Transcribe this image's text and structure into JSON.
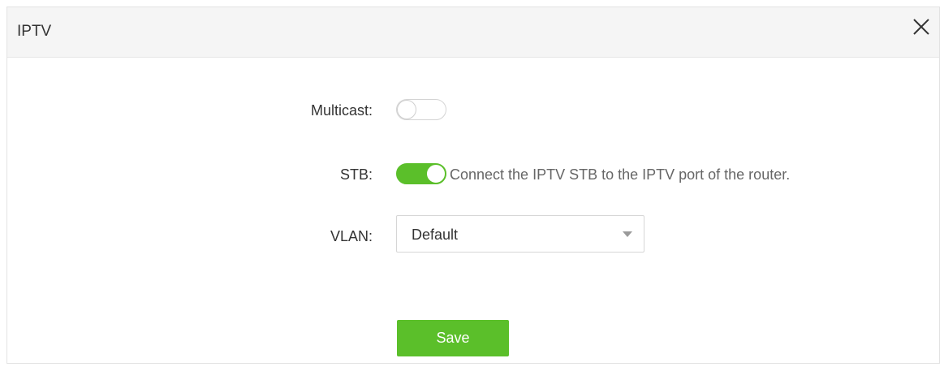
{
  "dialog": {
    "title": "IPTV",
    "close_icon": "close-icon"
  },
  "form": {
    "multicast": {
      "label": "Multicast:",
      "enabled": false
    },
    "stb": {
      "label": "STB:",
      "enabled": true,
      "hint": "Connect the IPTV STB to the IPTV port of the router."
    },
    "vlan": {
      "label": "VLAN:",
      "selected": "Default",
      "dropdown_icon": "caret-down-icon"
    }
  },
  "actions": {
    "save_label": "Save"
  },
  "colors": {
    "accent": "#5bbf2a",
    "header_bg": "#f5f5f5",
    "text": "#333333",
    "hint_text": "#666666"
  }
}
